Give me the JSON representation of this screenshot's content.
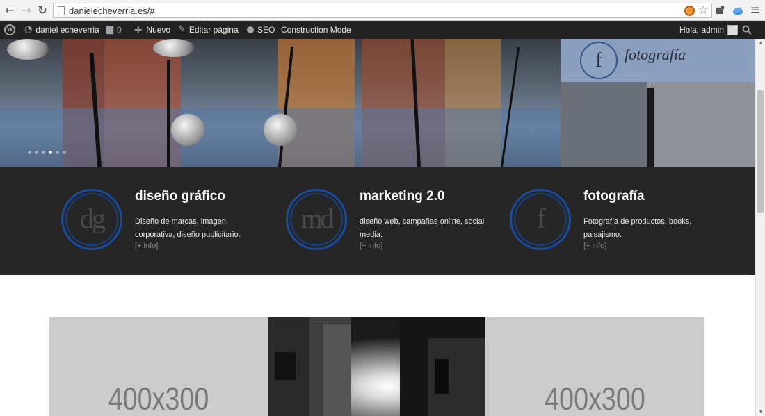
{
  "browser": {
    "url": "danielecheverria.es/#",
    "back_icon": "←",
    "forward_icon": "→",
    "reload_icon": "↻",
    "star_icon": "☆",
    "menu_icon": "≡"
  },
  "adminbar": {
    "site_name": "daniel echeverria",
    "comments_count": "0",
    "new_label": "Nuevo",
    "edit_label": "Editar página",
    "seo_label": "SEO",
    "construction_label": "Construction Mode",
    "greeting": "Hola, admin"
  },
  "hero": {
    "badge_letter": "f",
    "badge_text": "fotografía",
    "slides": 6,
    "active_slide": 4
  },
  "services": [
    {
      "monogram": "dg",
      "title": "diseño gráfico",
      "description": "Diseño de marcas, imagen corporativa, diseño publicitario.",
      "link": "[+ info]"
    },
    {
      "monogram": "md",
      "title": "marketing 2.0",
      "description": "diseño web, campañas online, social media.",
      "link": "[+ info]"
    },
    {
      "monogram": "f",
      "title": "fotografía",
      "description": "Fotografía de productos, books, paisajismo.",
      "link": "[+ info]"
    }
  ],
  "gallery": {
    "left_placeholder": "400x300",
    "right_placeholder": "400x300"
  },
  "colors": {
    "adminbar_bg": "#222222",
    "services_bg": "#262626",
    "ring_blue": "#1a4c9e",
    "placeholder_bg": "#cccccc"
  }
}
